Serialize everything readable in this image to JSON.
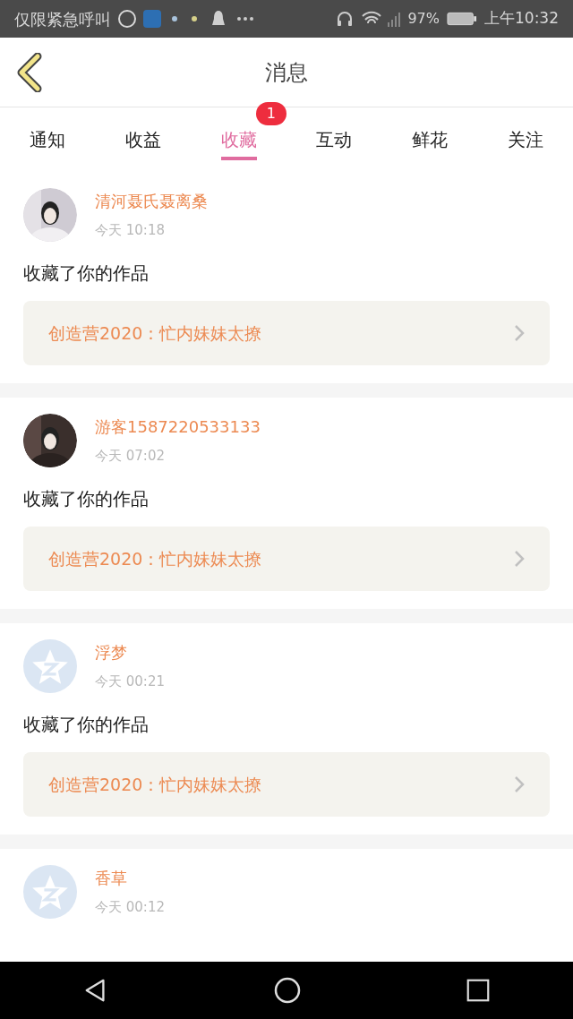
{
  "status_bar": {
    "carrier": "仅限紧急呼叫",
    "battery": "97%",
    "time": "上午10:32"
  },
  "header": {
    "title": "消息"
  },
  "tabs": [
    {
      "label": "通知",
      "selected": false
    },
    {
      "label": "收益",
      "selected": false
    },
    {
      "label": "收藏",
      "selected": true,
      "badge": "1"
    },
    {
      "label": "互动",
      "selected": false
    },
    {
      "label": "鲜花",
      "selected": false
    },
    {
      "label": "关注",
      "selected": false
    }
  ],
  "messages": [
    {
      "name": "清河聂氏聂离桑",
      "time": "今天 10:18",
      "text": "收藏了你的作品",
      "work": "创造营2020：忙内妹妹太撩"
    },
    {
      "name": "游客1587220533133",
      "time": "今天 07:02",
      "text": "收藏了你的作品",
      "work": "创造营2020：忙内妹妹太撩"
    },
    {
      "avatar": {
        "kind": "default"
      },
      "name": "浮梦",
      "time": "今天 00:21",
      "text": "收藏了你的作品",
      "work": "创造营2020：忙内妹妹太撩"
    },
    {
      "avatar": {
        "kind": "default"
      },
      "name": "香草",
      "time": "今天 00:12"
    }
  ]
}
